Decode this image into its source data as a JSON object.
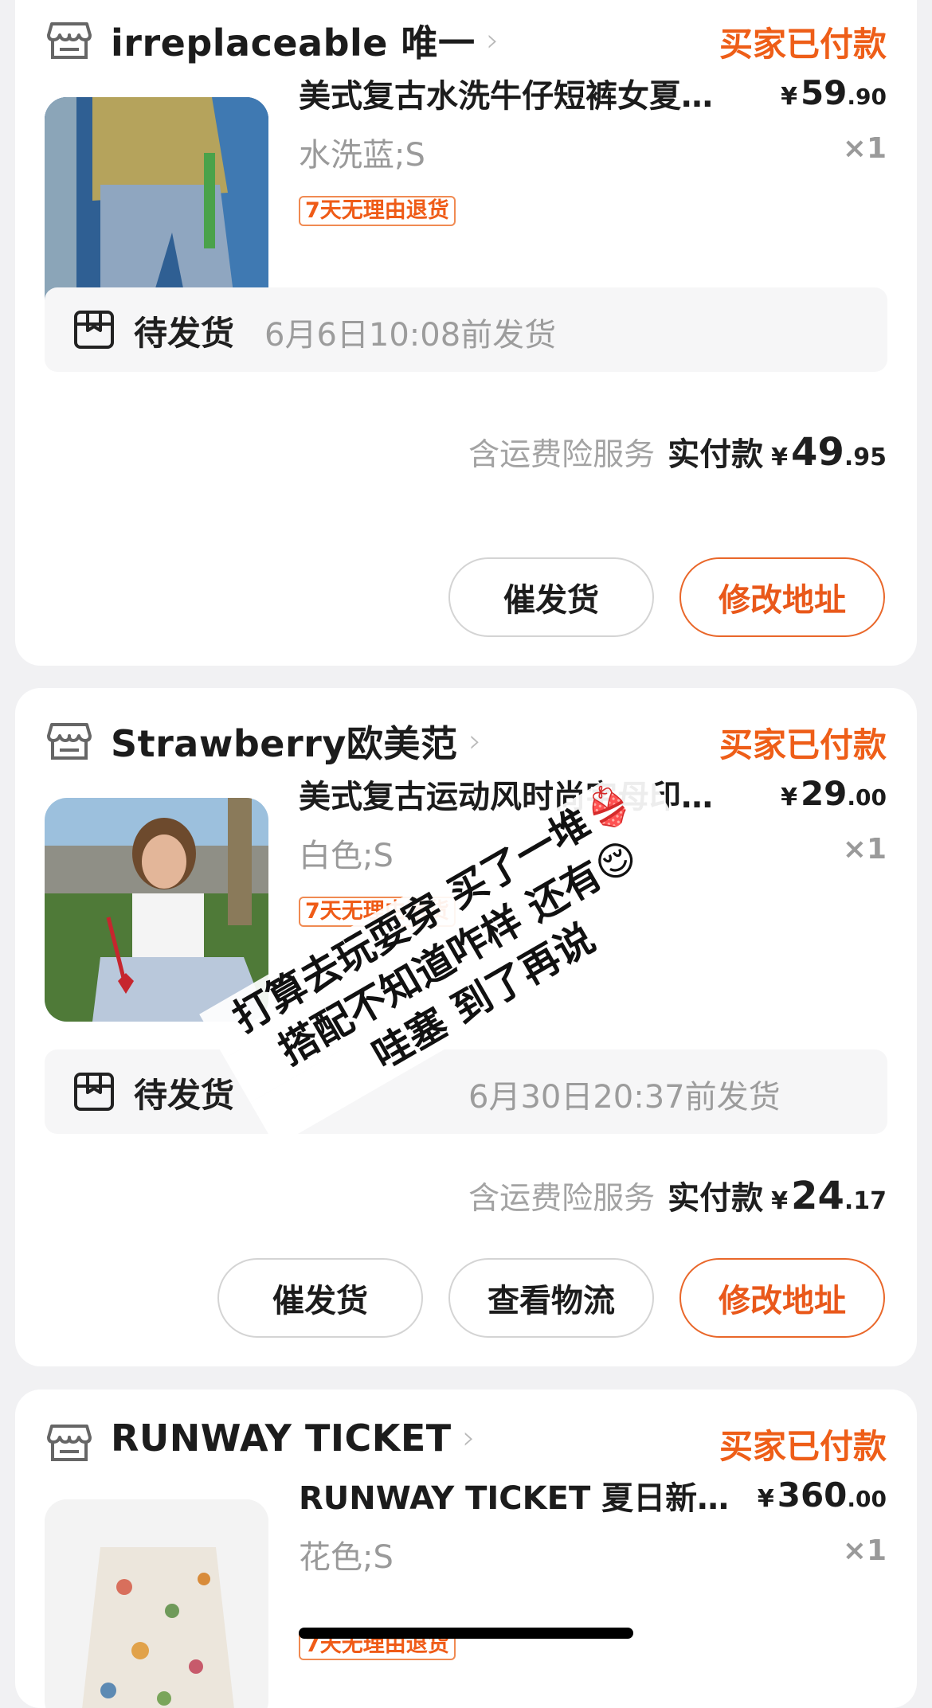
{
  "orders": [
    {
      "store_name": "irreplaceable 唯一",
      "status": "买家已付款",
      "item_title": "美式复古水洗牛仔短裤女夏…",
      "price_yen": "¥",
      "price_int": "59",
      "price_dec": ".90",
      "variant": "水洗蓝;S",
      "qty": "×1",
      "tag": "7天无理由退货",
      "ship_label": "待发货",
      "ship_time": "6月6日10:08前发货",
      "insurance": "含运费险服务",
      "paid_label": "实付款",
      "paid_yen": "¥",
      "paid_int": "49",
      "paid_dec": ".95",
      "buttons": [
        "催发货",
        "修改地址"
      ]
    },
    {
      "store_name": "Strawberry欧美范",
      "status": "买家已付款",
      "item_title": "美式复古运动风时尚字母印…",
      "price_yen": "¥",
      "price_int": "29",
      "price_dec": ".00",
      "variant": "白色;S",
      "qty": "×1",
      "tag": "7天无理由退货",
      "ship_label": "待发货",
      "ship_time": "6月30日20:37前发货",
      "insurance": "含运费险服务",
      "paid_label": "实付款",
      "paid_yen": "¥",
      "paid_int": "24",
      "paid_dec": ".17",
      "buttons": [
        "催发货",
        "查看物流",
        "修改地址"
      ]
    },
    {
      "store_name": "RUNWAY TICKET",
      "status": "买家已付款",
      "item_title": "RUNWAY TICKET 夏日新…",
      "price_yen": "¥",
      "price_int": "360",
      "price_dec": ".00",
      "variant": "花色;S",
      "qty": "×1",
      "tag": "7天无理由退货"
    }
  ],
  "overlay_text": {
    "line1": "打算去玩耍穿 买了一堆👙",
    "line2": "搭配不知道咋样 还有😌",
    "line3": "哇塞 到了再说"
  },
  "colors": {
    "accent": "#ee5e18",
    "background": "#f1f1f3",
    "card": "#ffffff"
  }
}
